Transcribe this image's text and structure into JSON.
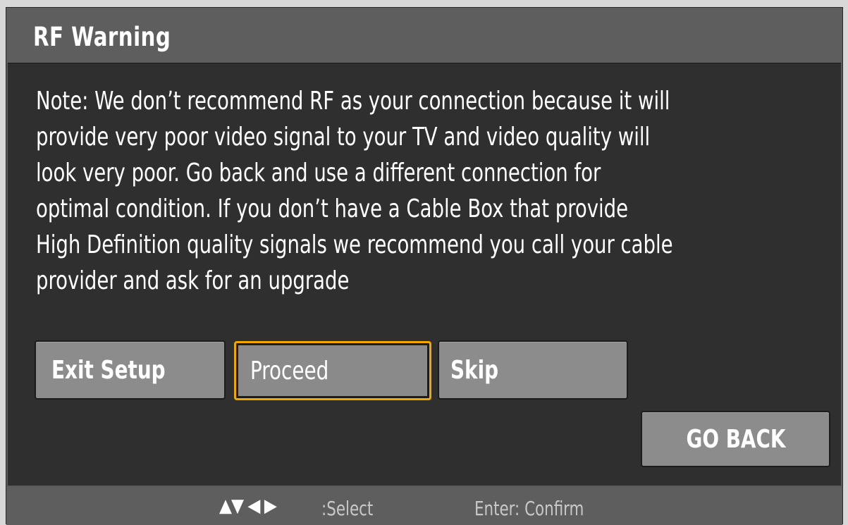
{
  "dialog": {
    "title": "RF Warning",
    "message": "Note: We don’t recommend RF as your connection because it will\nprovide very poor video signal to your TV and video quality will\nlook very poor. Go back and use a different connection for\noptimal condition. If you don’t have a Cable Box that provide\nHigh Definition quality signals we recommend you call your cable\nprovider and ask for an upgrade"
  },
  "buttons": {
    "exit_setup": "Exit Setup",
    "proceed": "Proceed",
    "skip": "Skip",
    "go_back": "GO BACK"
  },
  "selected_button": "proceed",
  "footer": {
    "arrows": "▲▼ ◀ ▶",
    "select_hint": ":Select",
    "confirm_hint": "Enter: Confirm"
  },
  "colors": {
    "focus_border": "#f0a800",
    "button_bg": "#8c8c8c",
    "content_bg": "#2f2f2f",
    "title_bar_bg": "#5e5e5e"
  }
}
